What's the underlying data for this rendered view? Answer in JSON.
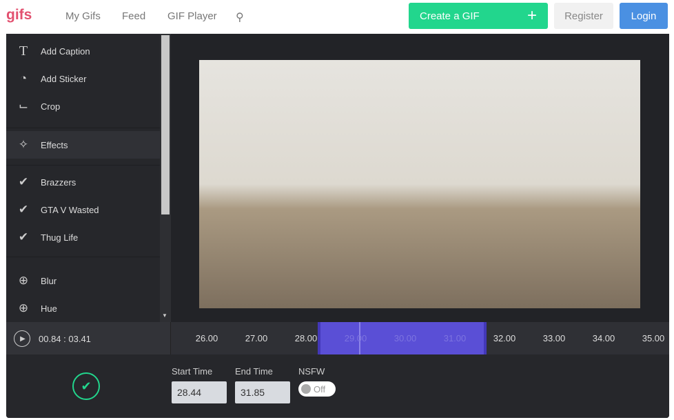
{
  "header": {
    "logo": "gifs",
    "nav": [
      "My Gifs",
      "Feed",
      "GIF Player"
    ],
    "create": "Create a GIF",
    "register": "Register",
    "login": "Login"
  },
  "sidebar": {
    "items": [
      {
        "label": "Add Caption",
        "icon": "text-icon"
      },
      {
        "label": "Add Sticker",
        "icon": "sticker-icon"
      },
      {
        "label": "Crop",
        "icon": "crop-icon"
      },
      {
        "label": "Effects",
        "icon": "magic-wand-icon"
      },
      {
        "label": "Brazzers",
        "icon": "check-icon"
      },
      {
        "label": "GTA V Wasted",
        "icon": "check-icon"
      },
      {
        "label": "Thug Life",
        "icon": "check-icon"
      },
      {
        "label": "Blur",
        "icon": "plus-circle-icon"
      },
      {
        "label": "Hue",
        "icon": "plus-circle-icon"
      }
    ]
  },
  "timeline": {
    "time": "00.84 : 03.41",
    "ticks": [
      "26.00",
      "27.00",
      "28.00",
      "29.00",
      "30.00",
      "31.00",
      "32.00",
      "33.00",
      "34.00",
      "35.00"
    ]
  },
  "controls": {
    "start_label": "Start Time",
    "start": "28.44",
    "end_label": "End Time",
    "end": "31.85",
    "nsfw_label": "NSFW",
    "nsfw": "Off"
  },
  "colors": {
    "accent": "#22d68d",
    "selection": "#5a4fd6",
    "login": "#4a90e2",
    "logo": "#e2506f"
  }
}
